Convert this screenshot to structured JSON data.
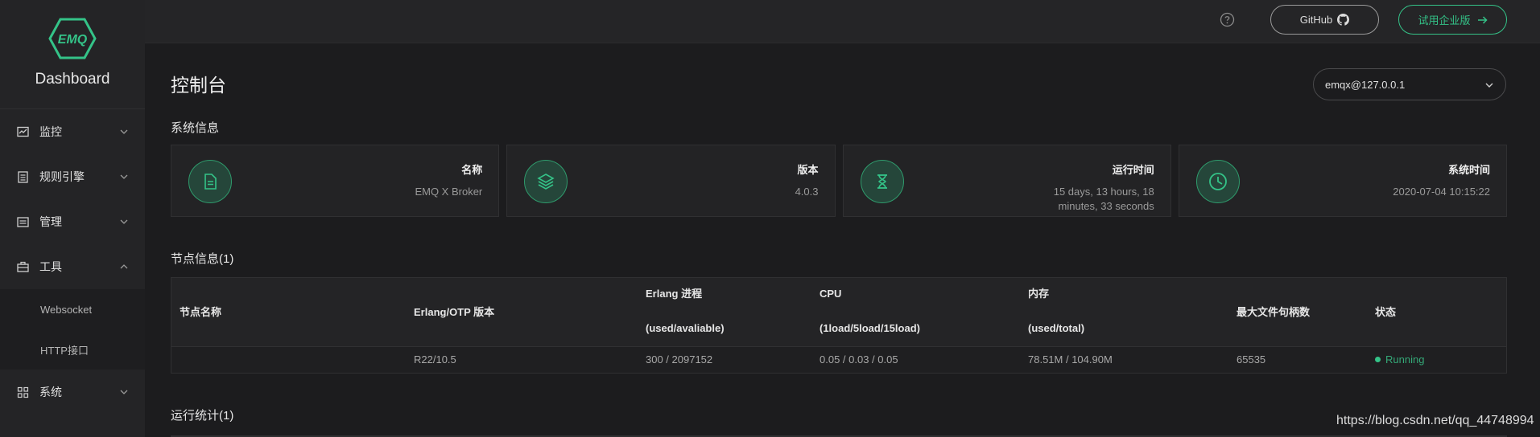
{
  "sidebar": {
    "logo_text": "EMQ",
    "app_title": "Dashboard",
    "items": [
      {
        "label": "监控",
        "icon": "monitor-icon"
      },
      {
        "label": "规则引擎",
        "icon": "rules-icon"
      },
      {
        "label": "管理",
        "icon": "manage-icon"
      },
      {
        "label": "工具",
        "icon": "toolbox-icon"
      },
      {
        "label": "系统",
        "icon": "grid-icon"
      }
    ],
    "tools_sub": [
      "Websocket",
      "HTTP接口"
    ]
  },
  "header": {
    "github_label": "GitHub",
    "trial_label": "试用企业版"
  },
  "main": {
    "title": "控制台",
    "node_selected": "emqx@127.0.0.1",
    "system_info_title": "系统信息",
    "cards": [
      {
        "label": "名称",
        "value": "EMQ X Broker",
        "icon": "document-icon"
      },
      {
        "label": "版本",
        "value": "4.0.3",
        "icon": "layers-icon"
      },
      {
        "label": "运行时间",
        "value": "15 days, 13 hours, 18 minutes, 33 seconds",
        "icon": "hourglass-icon"
      },
      {
        "label": "系统时间",
        "value": "2020-07-04 10:15:22",
        "icon": "clock-icon"
      }
    ],
    "node_info_title": "节点信息(1)",
    "table": {
      "headers": {
        "node_name": "节点名称",
        "otp": "Erlang/OTP 版本",
        "proc_l1": "Erlang 进程",
        "proc_l2": "(used/avaliable)",
        "cpu_l1": "CPU",
        "cpu_l2": "(1load/5load/15load)",
        "mem_l1": "内存",
        "mem_l2": "(used/total)",
        "files": "最大文件句柄数",
        "status": "状态"
      },
      "row": {
        "node_name": "",
        "otp": "R22/10.5",
        "proc": "300 / 2097152",
        "cpu": "0.05 / 0.03 / 0.05",
        "mem": "78.51M / 104.90M",
        "files": "65535",
        "status": "Running"
      }
    },
    "run_stats_title": "运行统计(1)"
  },
  "watermark": "https://blog.csdn.net/qq_44748994",
  "colors": {
    "accent": "#34c388",
    "background": "#1c1c1e",
    "sidebar": "#242426"
  }
}
